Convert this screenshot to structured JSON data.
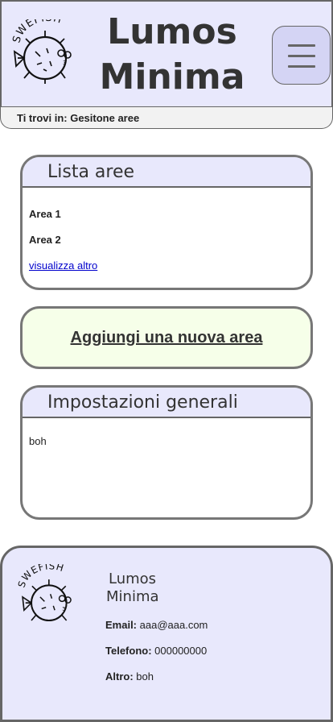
{
  "header": {
    "logo_text": "SWEFISH",
    "title_line1": "Lumos",
    "title_line2": "Minima",
    "menu_icon": "hamburger-menu-icon"
  },
  "breadcrumb": {
    "text": "Ti trovi in: Gesitone aree"
  },
  "areas_card": {
    "title": "Lista aree",
    "items": [
      "Area 1",
      "Area 2"
    ],
    "more_link": "visualizza altro"
  },
  "add_area": {
    "label": "Aggiungi una nuova area"
  },
  "settings_card": {
    "title": "Impostazioni generali",
    "body": "boh"
  },
  "footer": {
    "logo_text": "SWEFISH",
    "title_line1": "Lumos",
    "title_line2": "Minima",
    "email_label": "Email:",
    "email_value": " aaa@aaa.com",
    "phone_label": "Telefono:",
    "phone_value": " 000000000",
    "other_label": "Altro:",
    "other_value": " boh"
  },
  "colors": {
    "header_bg": "#e8e8fc",
    "add_button_bg": "#f6ffe9",
    "border": "#777777",
    "link": "#0000cc"
  }
}
